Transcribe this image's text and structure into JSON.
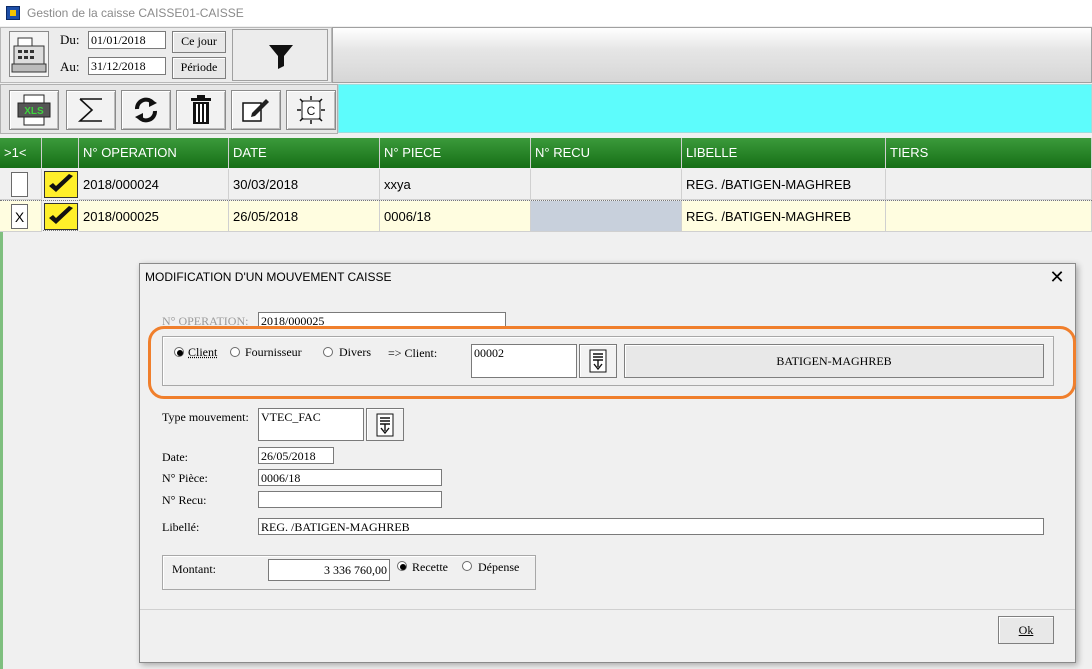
{
  "window": {
    "title": "Gestion de la caisse CAISSE01-CAISSE"
  },
  "filter": {
    "from_label": "Du:",
    "to_label": "Au:",
    "from_date": "01/01/2018",
    "to_date": "31/12/2018",
    "today_button": "Ce jour",
    "period_button": "Période"
  },
  "toolbar": {
    "buttons": [
      "excel-export-icon",
      "sum-icon",
      "refresh-icon",
      "trash-icon",
      "edit-icon",
      "cash-register-icon"
    ],
    "xls_text": "XLS",
    "c_text": "C"
  },
  "grid": {
    "columns": [
      "&gt;1&lt;",
      "",
      "N° OPERATION",
      "DATE",
      "N° PIECE",
      "N° RECU",
      "LIBELLE",
      "TIERS"
    ],
    "rows": [
      {
        "check": "",
        "operation": "2018/000024",
        "date": "30/03/2018",
        "piece": "xxya",
        "recu": "",
        "libelle": "REG. /BATIGEN-MAGHREB",
        "tiers": ""
      },
      {
        "check": "X",
        "operation": "2018/000025",
        "date": "26/05/2018",
        "piece": "0006/18",
        "recu": "",
        "libelle": "REG. /BATIGEN-MAGHREB",
        "tiers": ""
      }
    ]
  },
  "dialog": {
    "title": "MODIFICATION D'UN MOUVEMENT CAISSE",
    "close": "X",
    "operation_label": "N° OPERATION:",
    "operation_value": "2018/000025",
    "radio_client": "Client",
    "radio_fournisseur": "Fournisseur",
    "radio_divers": "Divers",
    "selected_radio": "Client",
    "client_label": "=> Client:",
    "client_code": "00002",
    "client_name": "BATIGEN-MAGHREB",
    "type_label": "Type mouvement:",
    "type_value": "VTEC_FAC",
    "date_label": "Date:",
    "date_value": "26/05/2018",
    "piece_label": "N° Pièce:",
    "piece_value": "0006/18",
    "recu_label": "N° Recu:",
    "recu_value": "",
    "libelle_label": "Libellé:",
    "libelle_value": "REG. /BATIGEN-MAGHREB",
    "montant_label": "Montant:",
    "montant_value": "3 336 760,00",
    "radio_recette": "Recette",
    "radio_depense": "Dépense",
    "selected_flow": "Recette",
    "ok_button": "Ok"
  },
  "colors": {
    "grid_header": "#1e7e1e",
    "cyan_bar": "#5dfcfc",
    "highlight": "#f07f2c",
    "tick_bg": "#ffef2a"
  }
}
